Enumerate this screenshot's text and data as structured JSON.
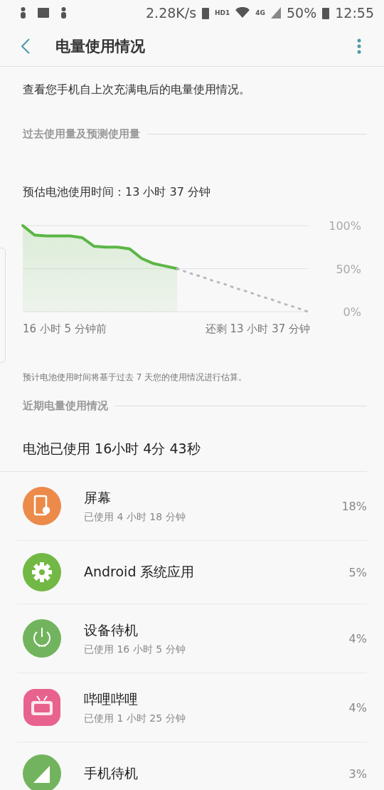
{
  "status_bar": {
    "speed": "2.28K/s",
    "hd": "HD1",
    "network": "4G",
    "battery": "50%",
    "time": "12:55"
  },
  "app_bar": {
    "title": "电量使用情况"
  },
  "intro": "查看您手机自上次充满电后的电量使用情况。",
  "history_section": {
    "header": "过去使用量及预测使用量",
    "estimate": "预估电池使用时间：13 小时 37 分钟",
    "chart_data": {
      "type": "area",
      "yticks": [
        {
          "value": 100,
          "label": "100%"
        },
        {
          "value": 50,
          "label": "50%"
        },
        {
          "value": 0,
          "label": "0%"
        }
      ],
      "ylim": [
        0,
        100
      ],
      "series": [
        {
          "color": "#5cb646",
          "values": [
            100,
            89,
            88,
            88,
            88,
            86,
            76,
            75,
            75,
            73,
            62,
            56,
            53,
            50,
            null,
            null,
            null,
            null,
            null,
            null,
            null,
            null,
            null,
            null,
            null
          ]
        },
        {
          "color": "#b8b8c0",
          "type": "line",
          "line_style": "dotted",
          "values": [
            null,
            null,
            null,
            null,
            null,
            null,
            null,
            null,
            null,
            null,
            null,
            null,
            null,
            50,
            45,
            41,
            36,
            32,
            27,
            23,
            18,
            14,
            9,
            5,
            0
          ]
        }
      ]
    },
    "start_label": "16 小时 5 分钟前",
    "end_label": "还剩 13 小时 37 分钟",
    "footnote": "预计电池使用时间将基于过去 7 天您的使用情况进行估算。"
  },
  "recent_section": {
    "header": "近期电量使用情况",
    "total": "电池已使用 16小时 4分 43秒",
    "apps": [
      {
        "kind": "screen",
        "color": "#ec8a4a",
        "name": "屏幕",
        "detail": "已使用 4 小时 18 分钟",
        "percent": "18%"
      },
      {
        "kind": "gear",
        "color": "#72b844",
        "name": "Android 系统应用",
        "percent": "5%"
      },
      {
        "kind": "power",
        "color": "#72b45e",
        "name": "设备待机",
        "detail": "已使用 16 小时 5 分钟",
        "percent": "4%"
      },
      {
        "kind": "tv",
        "color": "#e8628e",
        "name": "哔哩哔哩",
        "detail": "已使用 1 小时 25 分钟",
        "percent": "4%"
      },
      {
        "kind": "signal",
        "color": "#72b45e",
        "name": "手机待机",
        "percent": "3%"
      }
    ]
  }
}
